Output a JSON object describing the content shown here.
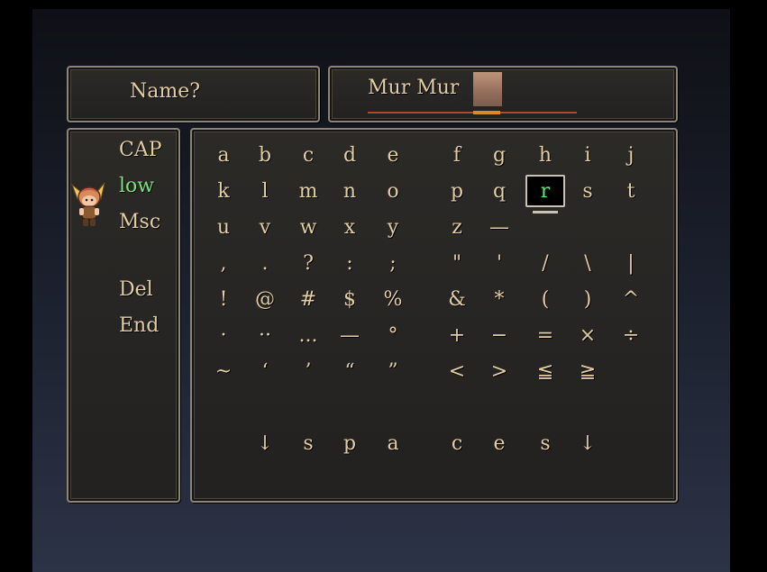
{
  "name_label": "Name?",
  "name_value": "Mur Mur",
  "modes": [
    {
      "label": "CAP",
      "active": false
    },
    {
      "label": "low",
      "active": true
    },
    {
      "label": "Msc",
      "active": false
    },
    {
      "label": "Del",
      "active": false
    },
    {
      "label": "End",
      "active": false
    }
  ],
  "keyboard": {
    "rows": [
      [
        "a",
        "b",
        "c",
        "d",
        "e",
        "f",
        "g",
        "h",
        "i",
        "j"
      ],
      [
        "k",
        "l",
        "m",
        "n",
        "o",
        "p",
        "q",
        "r",
        "s",
        "t"
      ],
      [
        "u",
        "v",
        "w",
        "x",
        "y",
        "z",
        "—",
        "",
        "",
        ""
      ],
      [
        ",",
        ".",
        "?",
        ":",
        ";",
        "\"",
        "'",
        "/",
        "\\",
        "|"
      ],
      [
        "!",
        "@",
        "#",
        "$",
        "%",
        "&",
        "*",
        "(",
        ")",
        "^"
      ],
      [
        "·",
        "··",
        "...",
        "—",
        "°",
        "+",
        "−",
        "=",
        "×",
        "÷"
      ],
      [
        "~",
        "‘",
        "’",
        "“",
        "”",
        "<",
        ">",
        "≦",
        "≧",
        ""
      ],
      [
        "",
        "",
        "",
        "",
        "",
        "",
        "",
        "",
        "",
        ""
      ],
      [
        "",
        "↓",
        "s",
        "p",
        "a",
        "c",
        "e",
        "s",
        "↓",
        ""
      ]
    ],
    "selected_key": "r"
  },
  "colors": {
    "text": "#e3cda3",
    "active_mode": "#7fe07a",
    "selected_key_text": "#5fe870",
    "panel_border": "#8a8577"
  },
  "icons": {
    "cursor": "winged-character-cursor-icon"
  }
}
